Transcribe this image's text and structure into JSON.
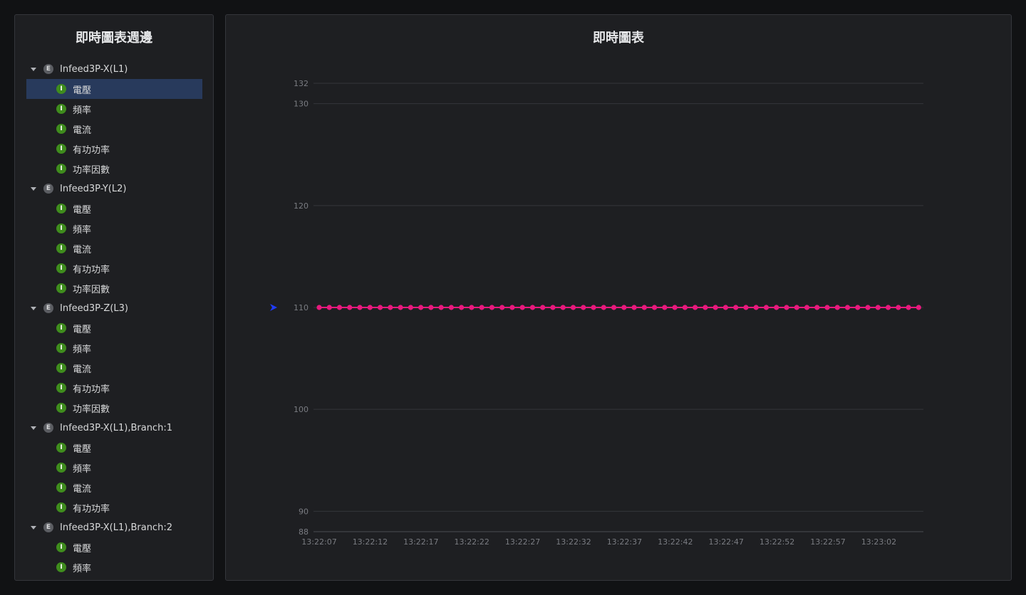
{
  "left_panel": {
    "title": "即時圖表週邊",
    "groups": [
      {
        "label": "Infeed3P-X(L1)",
        "badge": "E",
        "items": [
          {
            "label": "電壓",
            "badge": "I",
            "selected": true
          },
          {
            "label": "頻率",
            "badge": "I"
          },
          {
            "label": "電流",
            "badge": "I"
          },
          {
            "label": "有功功率",
            "badge": "I"
          },
          {
            "label": "功率因數",
            "badge": "I"
          }
        ]
      },
      {
        "label": "Infeed3P-Y(L2)",
        "badge": "E",
        "items": [
          {
            "label": "電壓",
            "badge": "I"
          },
          {
            "label": "頻率",
            "badge": "I"
          },
          {
            "label": "電流",
            "badge": "I"
          },
          {
            "label": "有功功率",
            "badge": "I"
          },
          {
            "label": "功率因數",
            "badge": "I"
          }
        ]
      },
      {
        "label": "Infeed3P-Z(L3)",
        "badge": "E",
        "items": [
          {
            "label": "電壓",
            "badge": "I"
          },
          {
            "label": "頻率",
            "badge": "I"
          },
          {
            "label": "電流",
            "badge": "I"
          },
          {
            "label": "有功功率",
            "badge": "I"
          },
          {
            "label": "功率因數",
            "badge": "I"
          }
        ]
      },
      {
        "label": "Infeed3P-X(L1),Branch:1",
        "badge": "E",
        "items": [
          {
            "label": "電壓",
            "badge": "I"
          },
          {
            "label": "頻率",
            "badge": "I"
          },
          {
            "label": "電流",
            "badge": "I"
          },
          {
            "label": "有功功率",
            "badge": "I"
          }
        ]
      },
      {
        "label": "Infeed3P-X(L1),Branch:2",
        "badge": "E",
        "items": [
          {
            "label": "電壓",
            "badge": "I"
          },
          {
            "label": "頻率",
            "badge": "I"
          }
        ]
      }
    ]
  },
  "right_panel": {
    "title": "即時圖表"
  },
  "chart_data": {
    "type": "line",
    "title": "即時圖表",
    "xlabel": "",
    "ylabel": "",
    "ylim": [
      88,
      132
    ],
    "yticks": [
      88,
      90,
      100,
      110,
      120,
      130,
      132
    ],
    "x_ticks": [
      "13:22:07",
      "13:22:12",
      "13:22:17",
      "13:22:22",
      "13:22:27",
      "13:22:32",
      "13:22:37",
      "13:22:42",
      "13:22:47",
      "13:22:52",
      "13:22:57",
      "13:23:02"
    ],
    "x_range_seconds_from_first_tick": [
      0,
      59
    ],
    "grid": true,
    "series": [
      {
        "color": "#e8197d",
        "marker": "circle",
        "y": [
          110,
          110,
          110,
          110,
          110,
          110,
          110,
          110,
          110,
          110,
          110,
          110,
          110,
          110,
          110,
          110,
          110,
          110,
          110,
          110,
          110,
          110,
          110,
          110,
          110,
          110,
          110,
          110,
          110,
          110,
          110,
          110,
          110,
          110,
          110,
          110,
          110,
          110,
          110,
          110,
          110,
          110,
          110,
          110,
          110,
          110,
          110,
          110,
          110,
          110,
          110,
          110,
          110,
          110,
          110,
          110,
          110,
          110,
          110,
          110
        ]
      }
    ],
    "current_value_marker": {
      "value": 110,
      "color": "#1f3cff"
    },
    "colors": {
      "grid": "#34363b",
      "axis": "#4a4c52",
      "tick_text": "#7a7c82"
    }
  }
}
